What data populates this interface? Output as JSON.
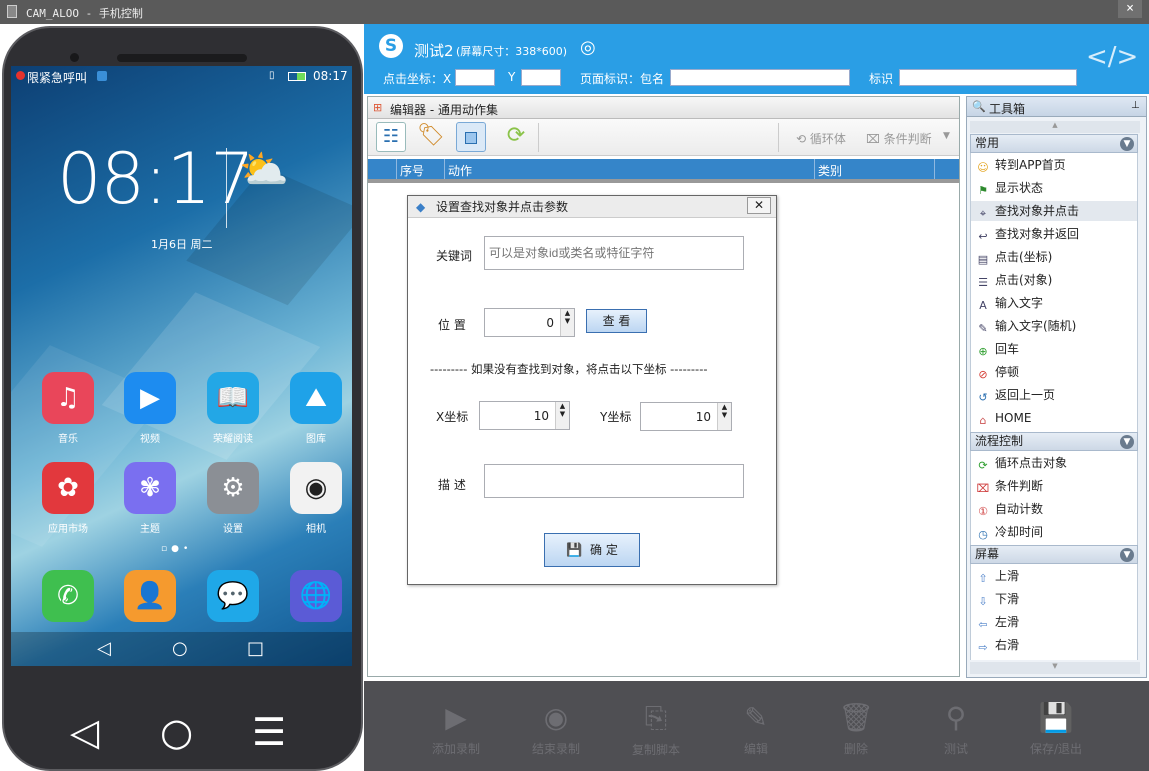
{
  "window": {
    "title": "CAM_ALOO  - 手机控制",
    "close_label": "×"
  },
  "phone": {
    "status_left": "限紧急呼叫",
    "status_time": "08:17",
    "clock": "08:17",
    "date": "1月6日  周二",
    "apps_row1": [
      {
        "label": "音乐",
        "icon": "music-icon",
        "color": "#e9465a",
        "glyph": "♫"
      },
      {
        "label": "视频",
        "icon": "video-play-icon",
        "color": "#1d8cf0",
        "glyph": "▶"
      },
      {
        "label": "荣耀阅读",
        "icon": "book-icon",
        "color": "#23a7e6",
        "glyph": "📖"
      },
      {
        "label": "图库",
        "icon": "gallery-icon",
        "color": "#1fa2e8",
        "glyph": "⛰"
      }
    ],
    "apps_row2": [
      {
        "label": "应用市场",
        "icon": "huawei-appstore-icon",
        "color": "#e2383d",
        "glyph": "✿"
      },
      {
        "label": "主题",
        "icon": "theme-icon",
        "color": "#7a6ff0",
        "glyph": "✾"
      },
      {
        "label": "设置",
        "icon": "settings-gear-icon",
        "color": "#8b8f95",
        "glyph": "⚙"
      },
      {
        "label": "相机",
        "icon": "camera-icon",
        "color": "#f2f2f2",
        "glyph": "◉"
      }
    ],
    "dock": [
      {
        "icon": "phone-call-icon",
        "color": "#3fbf4f",
        "glyph": "✆"
      },
      {
        "icon": "contacts-icon",
        "color": "#f59a2e",
        "glyph": "👤"
      },
      {
        "icon": "messages-icon",
        "color": "#1fa8e8",
        "glyph": "💬"
      },
      {
        "icon": "browser-globe-icon",
        "color": "#5b5bd6",
        "glyph": "🌐"
      }
    ]
  },
  "header": {
    "title": "测试2",
    "screen_size": "(屏幕尺寸：338*600)",
    "click_coord_label": "点击坐标：X",
    "y_label": "Y",
    "x_value": "",
    "y_value": "",
    "page_id_label": "页面标识：包名",
    "page_id_value": "",
    "mark_label": "标识",
    "mark_value": ""
  },
  "editor": {
    "title": "编辑器 - 通用动作集",
    "loop_label": "循环体",
    "cond_label": "条件判断",
    "columns": {
      "index": "序号",
      "action": "动作",
      "category": "类别"
    }
  },
  "toolbox": {
    "title": "工具箱",
    "sections": [
      {
        "title": "常用",
        "items": [
          {
            "label": "转到APP首页",
            "icon": "smiley-icon"
          },
          {
            "label": "显示状态",
            "icon": "flag-icon"
          },
          {
            "label": "查找对象并点击",
            "icon": "cursor-find-icon"
          },
          {
            "label": "查找对象并返回",
            "icon": "return-arrow-icon"
          },
          {
            "label": "点击(坐标)",
            "icon": "doc-click-icon"
          },
          {
            "label": "点击(对象)",
            "icon": "list-click-icon"
          },
          {
            "label": "输入文字",
            "icon": "text-a-icon"
          },
          {
            "label": "输入文字(随机)",
            "icon": "pen-text-icon"
          },
          {
            "label": "回车",
            "icon": "enter-circle-icon"
          },
          {
            "label": "停顿",
            "icon": "pause-circle-icon"
          },
          {
            "label": "返回上一页",
            "icon": "back-arrow-icon"
          },
          {
            "label": "HOME",
            "icon": "home-icon"
          }
        ]
      },
      {
        "title": "流程控制",
        "items": [
          {
            "label": "循环点击对象",
            "icon": "loop-icon"
          },
          {
            "label": "条件判断",
            "icon": "condition-icon"
          },
          {
            "label": "自动计数",
            "icon": "counter-icon"
          },
          {
            "label": "冷却时间",
            "icon": "timer-icon"
          }
        ]
      },
      {
        "title": "屏幕",
        "items": [
          {
            "label": "上滑",
            "icon": "arrow-up-icon"
          },
          {
            "label": "下滑",
            "icon": "arrow-down-icon"
          },
          {
            "label": "左滑",
            "icon": "arrow-left-icon"
          },
          {
            "label": "右滑",
            "icon": "arrow-right-icon"
          }
        ]
      }
    ]
  },
  "bottom": [
    {
      "label": "添加录制",
      "icon": "record-icon",
      "glyph": "▶"
    },
    {
      "label": "结束录制",
      "icon": "stop-record-icon",
      "glyph": "◉"
    },
    {
      "label": "复制脚本",
      "icon": "copy-script-icon",
      "glyph": "⎘"
    },
    {
      "label": "编辑",
      "icon": "edit-icon",
      "glyph": "✎"
    },
    {
      "label": "删除",
      "icon": "trash-icon",
      "glyph": "🗑"
    },
    {
      "label": "测试",
      "icon": "test-search-icon",
      "glyph": "⚲"
    },
    {
      "label": "保存/退出",
      "icon": "save-icon",
      "glyph": "💾"
    }
  ],
  "dialog": {
    "title": "设置查找对象并点击参数",
    "keyword_label": "关键词",
    "keyword_placeholder": "可以是对象id或类名或特征字符",
    "position_label": "位  置",
    "position_value": "0",
    "view_button": "查 看",
    "separator": "--------- 如果没有查找到对象，将点击以下坐标 ---------",
    "x_label": "X坐标",
    "x_value": "10",
    "y_label": "Y坐标",
    "y_value": "10",
    "desc_label": "描  述",
    "desc_value": "",
    "ok_button": "确 定"
  }
}
